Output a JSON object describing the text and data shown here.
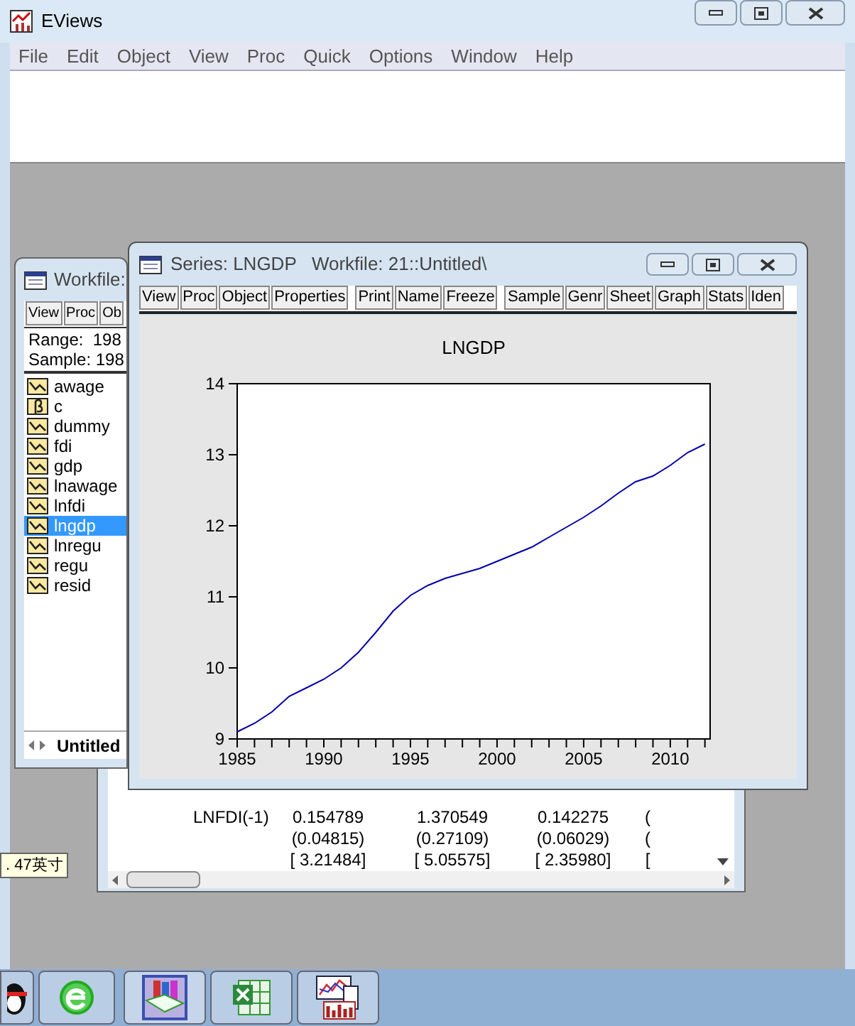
{
  "window": {
    "title": "EViews"
  },
  "menu": [
    "File",
    "Edit",
    "Object",
    "View",
    "Proc",
    "Quick",
    "Options",
    "Window",
    "Help"
  ],
  "workfile_window": {
    "title": "Workfile:",
    "buttons": [
      "View",
      "Proc",
      "Ob"
    ],
    "range": "Range:  198",
    "sample": "Sample: 198",
    "tab": "Untitled",
    "items": [
      {
        "name": "awage",
        "kind": "series",
        "selected": false
      },
      {
        "name": "c",
        "kind": "coef",
        "selected": false
      },
      {
        "name": "dummy",
        "kind": "series",
        "selected": false
      },
      {
        "name": "fdi",
        "kind": "series",
        "selected": false
      },
      {
        "name": "gdp",
        "kind": "series",
        "selected": false
      },
      {
        "name": "lnawage",
        "kind": "series",
        "selected": false
      },
      {
        "name": "lnfdi",
        "kind": "series",
        "selected": false
      },
      {
        "name": "lngdp",
        "kind": "series",
        "selected": true
      },
      {
        "name": "lnregu",
        "kind": "series",
        "selected": false
      },
      {
        "name": "regu",
        "kind": "series",
        "selected": false
      },
      {
        "name": "resid",
        "kind": "series",
        "selected": false
      }
    ]
  },
  "estimation_window": {
    "rows": [
      [
        "LNFDI(-1)",
        "0.154789",
        "1.370549",
        "0.142275",
        "("
      ],
      [
        "",
        "(0.04815)",
        "(0.27109)",
        "(0.06029)",
        "("
      ],
      [
        "",
        "[ 3.21484]",
        "[ 5.05575]",
        "[ 2.35980]",
        "["
      ]
    ]
  },
  "series_window": {
    "title": "Series: LNGDP   Workfile: 21::Untitled\\",
    "toolbar": [
      [
        "View",
        "Proc",
        "Object",
        "Properties"
      ],
      [
        "Print",
        "Name",
        "Freeze"
      ],
      [
        "Sample",
        "Genr",
        "Sheet",
        "Graph",
        "Stats",
        "Iden"
      ]
    ],
    "chart_data": {
      "type": "line",
      "title": "LNGDP",
      "x": [
        1985,
        1986,
        1987,
        1988,
        1989,
        1990,
        1991,
        1992,
        1993,
        1994,
        1995,
        1996,
        1997,
        1998,
        1999,
        2000,
        2001,
        2002,
        2003,
        2004,
        2005,
        2006,
        2007,
        2008,
        2009,
        2010,
        2011,
        2012
      ],
      "series": [
        {
          "color": "#0000aa",
          "values": [
            9.1,
            9.22,
            9.38,
            9.6,
            9.72,
            9.84,
            10.0,
            10.22,
            10.5,
            10.8,
            11.02,
            11.16,
            11.26,
            11.33,
            11.4,
            11.5,
            11.6,
            11.7,
            11.84,
            11.98,
            12.12,
            12.28,
            12.46,
            12.62,
            12.7,
            12.85,
            13.03,
            13.15
          ]
        }
      ],
      "xlim": [
        1985,
        2012.3
      ],
      "ylim": [
        9,
        14
      ],
      "xticks": [
        1985,
        1990,
        1995,
        2000,
        2005,
        2010
      ],
      "yticks": [
        9,
        10,
        11,
        12,
        13,
        14
      ]
    }
  },
  "tooltip": ". 47英寸"
}
